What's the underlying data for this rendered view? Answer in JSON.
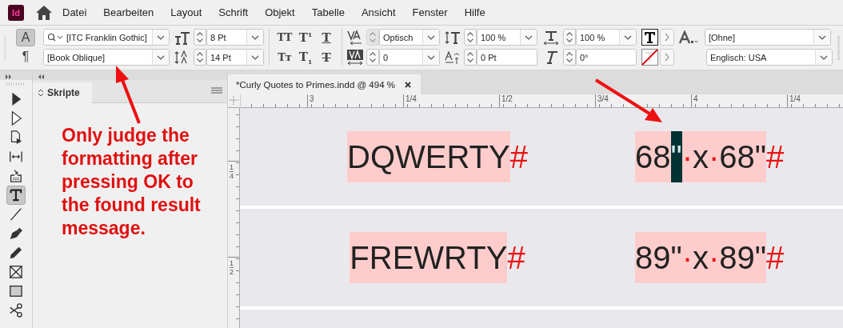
{
  "app": {
    "logo": "Id"
  },
  "menu": [
    "Datei",
    "Bearbeiten",
    "Layout",
    "Schrift",
    "Objekt",
    "Tabelle",
    "Ansicht",
    "Fenster",
    "Hilfe"
  ],
  "control_panel": {
    "mode_buttons": [
      {
        "label": "A",
        "selected": true
      },
      {
        "label": "¶",
        "selected": false
      }
    ],
    "font_family": "[ITC Franklin Gothic]",
    "font_style": "[Book Oblique]",
    "font_size": "8 Pt",
    "leading": "14 Pt",
    "style_buttons": [
      {
        "kind": "all-caps",
        "label": "TT"
      },
      {
        "kind": "superscript",
        "label": "T$^{1}$"
      },
      {
        "kind": "underline",
        "label": "T"
      },
      {
        "kind": "small-caps",
        "label": "Tт"
      },
      {
        "kind": "subscript",
        "label": "T$_{1}$"
      },
      {
        "kind": "strikethrough",
        "label": "T"
      }
    ],
    "kerning": "Optisch",
    "tracking": "0",
    "vertical_scale": "100 %",
    "horizontal_scale": "100 %",
    "baseline_shift": "0 Pt",
    "skew": "0°",
    "character_style": "[Ohne]",
    "language": "Englisch: USA"
  },
  "tools": [
    {
      "kind": "selection",
      "selected": false
    },
    {
      "kind": "direct-selection",
      "selected": false
    },
    {
      "kind": "page",
      "selected": false
    },
    {
      "kind": "gap",
      "selected": false
    },
    {
      "kind": "content-collector",
      "selected": false
    },
    {
      "kind": "type",
      "selected": true
    },
    {
      "kind": "line",
      "selected": false
    },
    {
      "kind": "pen",
      "selected": false
    },
    {
      "kind": "pencil",
      "selected": false
    },
    {
      "kind": "frame",
      "selected": false
    },
    {
      "kind": "rectangle",
      "selected": false
    },
    {
      "kind": "scissors",
      "selected": false
    }
  ],
  "panel": {
    "title": "Skripte",
    "note": "Only judge the formatting after pressing OK to the found result message."
  },
  "document": {
    "tab": "*Curly Quotes to Primes.indd @ 494 %",
    "ruler_labels": [
      "3",
      "1/4",
      "1/2",
      "3/4",
      "4",
      "1/4"
    ],
    "vertical_ruler_labels": [
      {
        "numerator": "1",
        "denominator": "4"
      },
      {
        "numerator": "1",
        "denominator": "2"
      }
    ],
    "rows": [
      {
        "left": [
          {
            "kind": "text",
            "text": "DQWERTY",
            "selected": false,
            "highlighted": true
          },
          {
            "kind": "marker",
            "text": "#",
            "selected": false,
            "highlighted": false
          }
        ],
        "right": [
          {
            "kind": "text",
            "text": "68",
            "selected": false,
            "highlighted": true
          },
          {
            "kind": "text",
            "text": "\"",
            "selected": true,
            "highlighted": true
          },
          {
            "kind": "marker",
            "text": "·",
            "selected": false,
            "highlighted": true
          },
          {
            "kind": "text",
            "text": "x",
            "selected": false,
            "highlighted": true
          },
          {
            "kind": "marker",
            "text": "·",
            "selected": false,
            "highlighted": true
          },
          {
            "kind": "text",
            "text": "68\"",
            "selected": false,
            "highlighted": true
          },
          {
            "kind": "marker",
            "text": "#",
            "selected": false,
            "highlighted": false
          }
        ]
      },
      {
        "left": [
          {
            "kind": "text",
            "text": "FREWRTY",
            "selected": false,
            "highlighted": true
          },
          {
            "kind": "marker",
            "text": "#",
            "selected": false,
            "highlighted": false
          }
        ],
        "right": [
          {
            "kind": "text",
            "text": "89\"",
            "selected": false,
            "highlighted": true
          },
          {
            "kind": "marker",
            "text": "·",
            "selected": false,
            "highlighted": true
          },
          {
            "kind": "text",
            "text": "x",
            "selected": false,
            "highlighted": true
          },
          {
            "kind": "marker",
            "text": "·",
            "selected": false,
            "highlighted": true
          },
          {
            "kind": "text",
            "text": "89\"",
            "selected": false,
            "highlighted": true
          },
          {
            "kind": "marker",
            "text": "#",
            "selected": false,
            "highlighted": false
          }
        ]
      }
    ]
  }
}
